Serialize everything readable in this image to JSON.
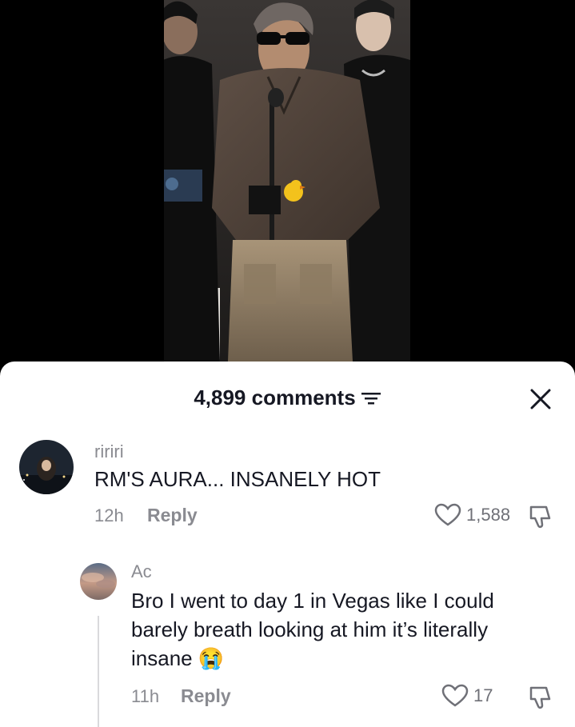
{
  "comments_panel": {
    "count_label": "4,899 comments"
  },
  "comments": [
    {
      "username": "ririri",
      "text": "RM'S AURA... INSANELY HOT",
      "time": "12h",
      "reply_label": "Reply",
      "likes": "1,588"
    }
  ],
  "replies": [
    {
      "username": "Ac",
      "text_line1": "Bro I went to day 1 in Vegas like I could",
      "text_line2": "barely breath looking at him it’s literally",
      "text_line3": "insane",
      "emoji": "😭",
      "time": "11h",
      "reply_label": "Reply",
      "likes": "17"
    }
  ],
  "colors": {
    "text_primary": "#161823",
    "text_secondary": "#8a8b91",
    "sheet_background": "#ffffff",
    "video_background": "#000000"
  }
}
